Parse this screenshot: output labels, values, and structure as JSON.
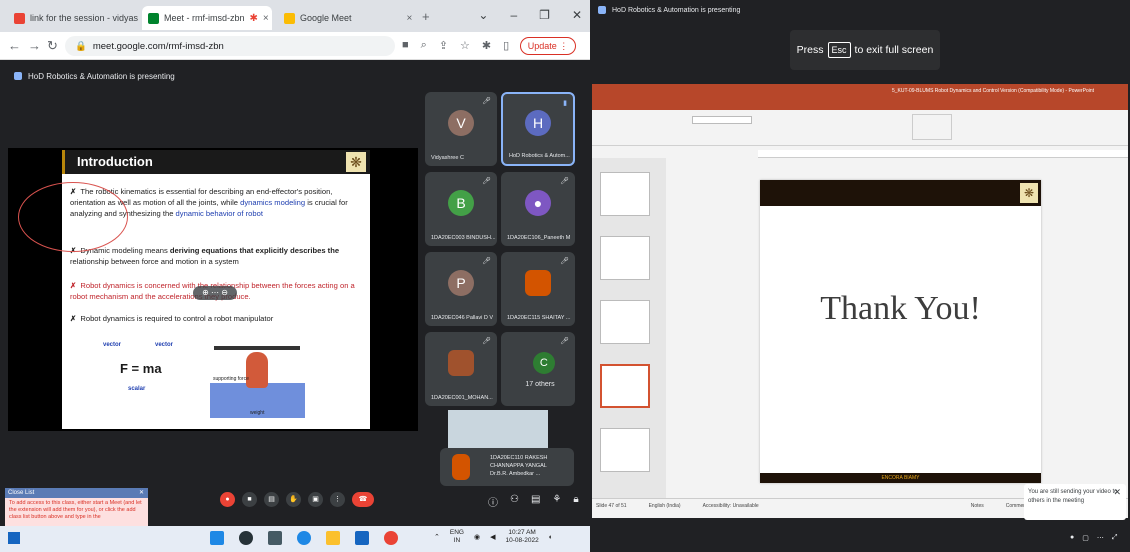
{
  "left": {
    "tabs": [
      {
        "label": "link for the session - vidyashree",
        "icon_color": "#ea4335"
      },
      {
        "label": "Meet - rmf-imsd-zbn",
        "icon_color": "#00832d",
        "active": true
      },
      {
        "label": "Google Meet",
        "icon_color": "#fbbc04"
      }
    ],
    "url": "meet.google.com/rmf-imsd-zbn",
    "update_label": "Update",
    "presenting_text": "HoD Robotics & Automation is presenting",
    "slide": {
      "title": "Introduction",
      "bullets": [
        {
          "pre": "The robotic kinematics is essential for describing an end-effector's position, orientation as well as motion of all the joints, while ",
          "hl": "dynamics modeling",
          "mid": " is crucial for analyzing and synthesizing the ",
          "hl2": "dynamic behavior of robot"
        },
        {
          "pre": "Dynamic modeling means ",
          "bold": "deriving equations that explicitly describes the",
          "post": " relationship between force and motion in a system"
        },
        {
          "red": "Robot dynamics is concerned with the relationship between the forces acting on a robot mechanism and the accelerations they produce."
        },
        {
          "pre": "Robot dynamics is required to control a robot manipulator"
        }
      ],
      "formula": "F = ma",
      "labels": {
        "vector1": "vector",
        "vector2": "vector",
        "scalar": "scalar",
        "supporting": "supporting force",
        "weight": "weight"
      }
    },
    "participants": [
      {
        "initial": "V",
        "name": "Vidyashree C",
        "color": "#8d6e63"
      },
      {
        "initial": "H",
        "name": "HoD Robotics & Autom...",
        "color": "#5c6bc0"
      },
      {
        "initial": "B",
        "name": "1DA20EC003 BINDUSH...",
        "color": "#43a047"
      },
      {
        "initial": "",
        "name": "1DA20EC106_Paneeth M",
        "color": "#7e57c2"
      },
      {
        "initial": "P",
        "name": "1DA20EC046 Pallavi D V",
        "color": "#8d6e63"
      },
      {
        "initial": "",
        "name": "1DA20EC115 SHAITAY ...",
        "color": "#d35400"
      },
      {
        "initial": "",
        "name": "1DA20EC001_MOHAN...",
        "color": "#a0522d"
      },
      {
        "initial": "C",
        "name": "17 others",
        "color": "#2e7d32"
      }
    ],
    "self_view": {
      "line1": "1DA20EC110 RAKESH",
      "line2": "CHANNAPPA YANGAL",
      "line3": "Dr.B.R. Ambedkar ..."
    },
    "close_window": {
      "title": "Close List",
      "text": "To add access to this class, either start a Meet (and let the extension will add them for you), or click the add class list button above and type in the"
    },
    "tray": {
      "lang": "ENG",
      "region": "IN",
      "time": "10:27 AM",
      "date": "10-08-2022"
    }
  },
  "right": {
    "presenting_text": "HoD Robotics & Automation is presenting",
    "esc_note": {
      "press": "Press",
      "key": "Esc",
      "rest": "to exit full screen"
    },
    "ppt_title": "5_KUT-09-BLUMS Robot Dynamics and Control Version (Compatibility Mode) - PowerPoint",
    "slide_text": "Thank You!",
    "slide_footer": "ENCORA BIAMY",
    "status": {
      "slide": "Slide 47 of 51",
      "lang": "English (India)",
      "access": "Accessibility: Unavailable",
      "notes": "Notes",
      "comments": "Comments"
    },
    "toast": "You are still sending your video to others in the meeting"
  },
  "colors": {
    "ppt_accent": "#b7472a",
    "meet_red": "#ea4335",
    "meet_bg": "#202124"
  }
}
